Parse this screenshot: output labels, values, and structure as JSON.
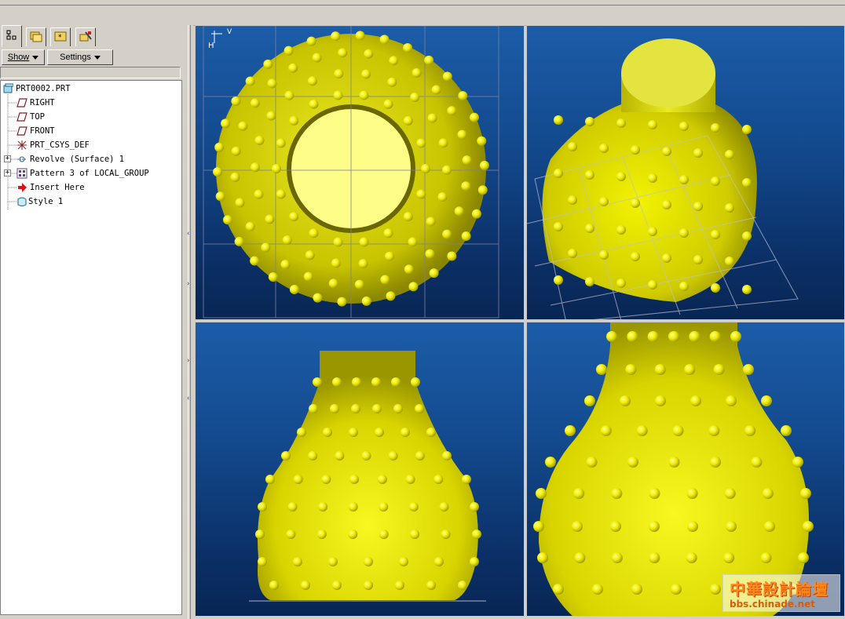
{
  "toolbar_tabs": [
    {
      "name": "model-tree-tab-icon",
      "active": true
    },
    {
      "name": "folder-browser-tab-icon",
      "active": false
    },
    {
      "name": "favorites-tab-icon",
      "active": false
    },
    {
      "name": "connections-tab-icon",
      "active": false
    }
  ],
  "buttons": {
    "show_label": "Show",
    "settings_label": "Settings"
  },
  "tree": {
    "items": [
      {
        "label": "PRT0002.PRT",
        "icon": "part-icon",
        "expandable": false,
        "indent": 0
      },
      {
        "label": "RIGHT",
        "icon": "datum-plane-icon",
        "expandable": false,
        "indent": 1
      },
      {
        "label": "TOP",
        "icon": "datum-plane-icon",
        "expandable": false,
        "indent": 1
      },
      {
        "label": "FRONT",
        "icon": "datum-plane-icon",
        "expandable": false,
        "indent": 1
      },
      {
        "label": "PRT_CSYS_DEF",
        "icon": "coordinate-system-icon",
        "expandable": false,
        "indent": 1
      },
      {
        "label": "Revolve (Surface) 1",
        "icon": "revolve-icon",
        "expandable": true,
        "indent": 1
      },
      {
        "label": "Pattern 3 of LOCAL_GROUP",
        "icon": "pattern-icon",
        "expandable": true,
        "indent": 1
      },
      {
        "label": "Insert Here",
        "icon": "insert-arrow-icon",
        "expandable": false,
        "indent": 1
      },
      {
        "label": "Style 1",
        "icon": "style-icon",
        "expandable": false,
        "indent": 1
      }
    ]
  },
  "viewports": [
    {
      "name": "top-view",
      "view": "top"
    },
    {
      "name": "iso-view",
      "view": "isometric"
    },
    {
      "name": "front-view",
      "view": "front"
    },
    {
      "name": "side-zoom-view",
      "view": "side-zoom"
    }
  ],
  "watermark": {
    "line1": "中華設計論壇",
    "line2": "bbs.chinade.net"
  },
  "colors": {
    "model_yellow": "#e8e800",
    "viewport_blue": "#134a8e",
    "panel_gray": "#d4d0c8"
  }
}
